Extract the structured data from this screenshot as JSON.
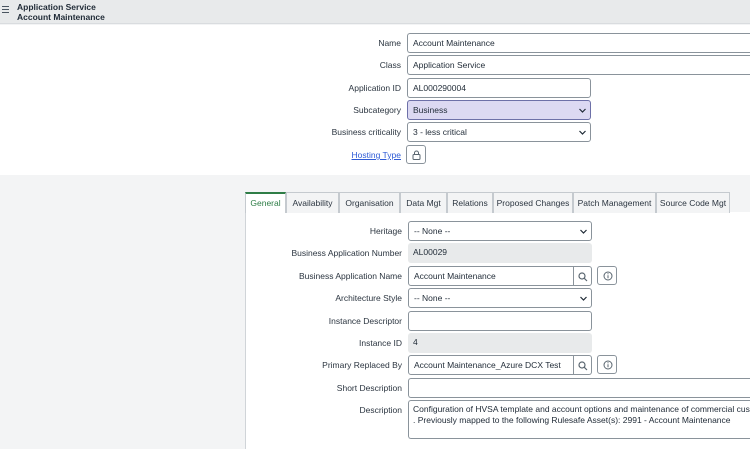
{
  "header": {
    "title": "Application Service",
    "subtitle": "Account Maintenance"
  },
  "top_form": {
    "name_label": "Name",
    "name_value": "Account Maintenance",
    "class_label": "Class",
    "class_value": "Application Service",
    "app_id_label": "Application ID",
    "app_id_value": "AL000290004",
    "subcategory_label": "Subcategory",
    "subcategory_value": "Business",
    "criticality_label": "Business criticality",
    "criticality_value": "3 - less critical",
    "hosting_label": "Hosting Type"
  },
  "tabs": [
    {
      "label": "General"
    },
    {
      "label": "Availability"
    },
    {
      "label": "Organisation"
    },
    {
      "label": "Data Mgt"
    },
    {
      "label": "Relations"
    },
    {
      "label": "Proposed Changes"
    },
    {
      "label": "Patch Management"
    },
    {
      "label": "Source Code Mgt"
    }
  ],
  "general": {
    "heritage_label": "Heritage",
    "heritage_value": "-- None --",
    "ban_label": "Business Application Number",
    "ban_value": "AL00029",
    "bname_label": "Business Application Name",
    "bname_value": "Account Maintenance",
    "arch_label": "Architecture Style",
    "arch_value": "-- None --",
    "instance_desc_label": "Instance Descriptor",
    "instance_desc_value": "",
    "instance_id_label": "Instance ID",
    "instance_id_value": "4",
    "primary_label": "Primary Replaced By",
    "primary_value": "Account Maintenance_Azure DCX Test",
    "short_desc_label": "Short Description",
    "short_desc_value": "",
    "desc_label": "Description",
    "desc_line1": "Configuration of HVSA template and account options and maintenance of commercial custome",
    "desc_line2": ". Previously mapped to the following Rulesafe Asset(s): 2991 - Account Maintenance"
  }
}
